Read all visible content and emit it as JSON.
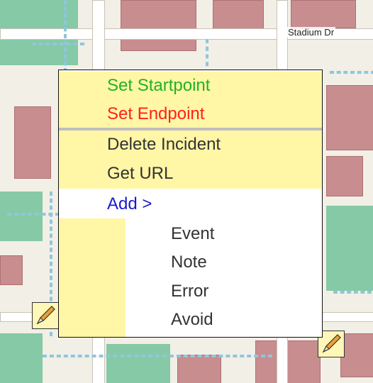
{
  "map": {
    "street_label": "Stadium Dr"
  },
  "context_menu": {
    "set_startpoint": "Set Startpoint",
    "set_endpoint": "Set Endpoint",
    "delete_incident": "Delete Incident",
    "get_url": "Get URL",
    "add": "Add >",
    "submenu": [
      "Event",
      "Note",
      "Error",
      "Avoid"
    ]
  },
  "colors": {
    "startpoint_text": "#22b322",
    "endpoint_text": "#ff2020",
    "add_text": "#1a1ad0",
    "menu_highlight": "#fff6a6",
    "building": "#c78d8f",
    "park": "#86c9a6"
  },
  "icons": {
    "incident_marker": "pencil-icon"
  }
}
